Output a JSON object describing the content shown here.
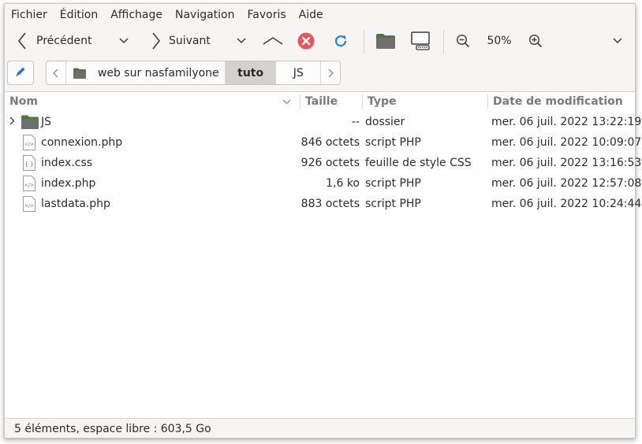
{
  "menubar": {
    "items": [
      "Fichier",
      "Édition",
      "Affichage",
      "Navigation",
      "Favoris",
      "Aide"
    ]
  },
  "toolbar": {
    "back_label": "Précédent",
    "forward_label": "Suivant",
    "zoom_level": "50%",
    "stop_color": "#e8565b",
    "reload_color": "#2b7bd8",
    "folder_color": "#4b7a38"
  },
  "location": {
    "crumbs": [
      {
        "label": "web sur nasfamilyone",
        "active": false
      },
      {
        "label": "tuto",
        "active": true
      },
      {
        "label": "JS",
        "active": false
      }
    ]
  },
  "filelist": {
    "columns": {
      "name": "Nom",
      "size": "Taille",
      "type": "Type",
      "modified": "Date de modification"
    },
    "rows": [
      {
        "name": "JS",
        "size": "--",
        "type": "dossier",
        "modified": "mer. 06 juil. 2022 13:22:19",
        "icon": "folder-icon"
      },
      {
        "name": "connexion.php",
        "size": "846 octets",
        "type": "script PHP",
        "modified": "mer. 06 juil. 2022 10:09:07",
        "icon": "php-file-icon"
      },
      {
        "name": "index.css",
        "size": "926 octets",
        "type": "feuille de style CSS",
        "modified": "mer. 06 juil. 2022 13:16:53",
        "icon": "css-file-icon"
      },
      {
        "name": "index.php",
        "size": "1,6 ko",
        "type": "script PHP",
        "modified": "mer. 06 juil. 2022 12:57:08",
        "icon": "php-file-icon"
      },
      {
        "name": "lastdata.php",
        "size": "883 octets",
        "type": "script PHP",
        "modified": "mer. 06 juil. 2022 10:24:44",
        "icon": "php-file-icon"
      }
    ]
  },
  "status": {
    "text": "5 éléments, espace libre : 603,5 Go"
  }
}
